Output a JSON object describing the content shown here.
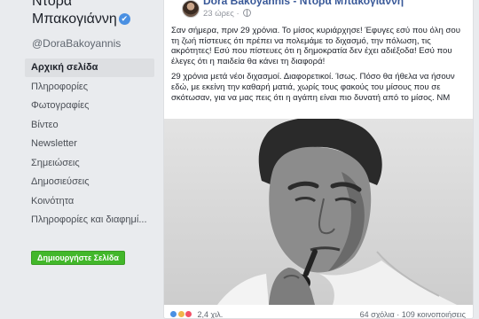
{
  "page": {
    "name_line1": "Ντόρα",
    "name_line2": "Μπακογιάννη",
    "verified_glyph": "✔",
    "handle": "@DoraBakoyannis"
  },
  "nav": {
    "items": [
      {
        "label": "Αρχική σελίδα",
        "active": true
      },
      {
        "label": "Πληροφορίες"
      },
      {
        "label": "Φωτογραφίες"
      },
      {
        "label": "Βίντεο"
      },
      {
        "label": "Newsletter"
      },
      {
        "label": "Σημειώσεις"
      },
      {
        "label": "Δημοσιεύσεις"
      },
      {
        "label": "Κοινότητα"
      },
      {
        "label": "Πληροφορίες και διαφημί..."
      }
    ]
  },
  "create_page_button": "Δημιουργήστε Σελίδα",
  "post": {
    "author": "Dora Bakoyannis - Ντόρα Μπακογιάννη",
    "time": "23 ώρες ·",
    "paragraph1": "Σαν σήμερα, πριν 29 χρόνια. Το μίσος κυριάρχησε! Έφυγες εσύ που όλη σου τη ζωή πίστευες ότι πρέπει να πολεμάμε το διχασμό, την πόλωση, τις ακρότητες! Εσύ που πίστευες ότι η δημοκρατία δεν έχει αδιέξοδα! Εσύ που έλεγες ότι η παιδεία θα κάνει τη διαφορά!",
    "paragraph2": "29 χρόνια μετά νέοι διχασμοί. Διαφορετικοί. Ίσως. Πόσο θα ήθελα να ήσουν εδώ, με εκείνη την καθαρή ματιά, χωρίς τους φακούς του μίσους που σε σκότωσαν, για να μας πεις ότι η αγάπη είναι πιο δυνατή από το μίσος. ΝΜ",
    "reactions_count": "2,4 χιλ.",
    "stats": "64 σχόλια · 109 κοινοποιήσεις"
  },
  "colors": {
    "link": "#385898",
    "button_green": "#42b72a",
    "background": "#e9ebee"
  }
}
